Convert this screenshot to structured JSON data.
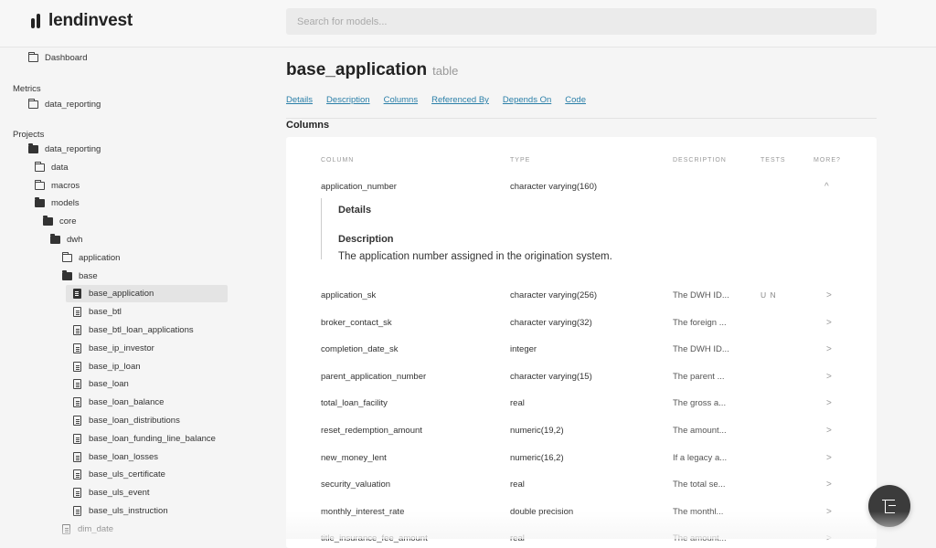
{
  "app": {
    "logo_text": "lendinvest",
    "logo_icon": "lendinvest-logo-icon"
  },
  "search": {
    "placeholder": "Search for models..."
  },
  "sidebar": {
    "dashboard": "Dashboard",
    "metrics_heading": "Metrics",
    "metrics_item": "data_reporting",
    "projects_heading": "Projects",
    "tree": [
      {
        "label": "data_reporting",
        "icon": "folder-open-icon"
      },
      {
        "label": "data",
        "icon": "folder-icon"
      },
      {
        "label": "macros",
        "icon": "folder-icon"
      },
      {
        "label": "models",
        "icon": "folder-open-icon"
      },
      {
        "label": "core",
        "icon": "folder-open-icon"
      },
      {
        "label": "dwh",
        "icon": "folder-open-icon"
      },
      {
        "label": "application",
        "icon": "folder-icon"
      },
      {
        "label": "base",
        "icon": "folder-open-icon"
      },
      {
        "label": "base_application",
        "icon": "file-filled-icon",
        "active": true
      },
      {
        "label": "base_btl",
        "icon": "file-icon"
      },
      {
        "label": "base_btl_loan_applications",
        "icon": "file-icon"
      },
      {
        "label": "base_ip_investor",
        "icon": "file-icon"
      },
      {
        "label": "base_ip_loan",
        "icon": "file-icon"
      },
      {
        "label": "base_loan",
        "icon": "file-icon"
      },
      {
        "label": "base_loan_balance",
        "icon": "file-icon"
      },
      {
        "label": "base_loan_distributions",
        "icon": "file-icon"
      },
      {
        "label": "base_loan_funding_line_balance",
        "icon": "file-icon"
      },
      {
        "label": "base_loan_losses",
        "icon": "file-icon"
      },
      {
        "label": "base_uls_certificate",
        "icon": "file-icon"
      },
      {
        "label": "base_uls_event",
        "icon": "file-icon"
      },
      {
        "label": "base_uls_instruction",
        "icon": "file-icon"
      },
      {
        "label": "dim_date",
        "icon": "file-icon"
      }
    ]
  },
  "main": {
    "title": "base_application",
    "title_type": "table",
    "tabs": [
      "Details",
      "Description",
      "Columns",
      "Referenced By",
      "Depends On",
      "Code"
    ],
    "section": "Columns",
    "columns_header": {
      "column": "COLUMN",
      "type": "TYPE",
      "description": "DESCRIPTION",
      "tests": "TESTS",
      "more": "MORE?"
    },
    "expanded": {
      "column": "application_number",
      "type": "character varying(160)",
      "chevron": "^",
      "details_label": "Details",
      "description_label": "Description",
      "description_text": "The application number assigned in the origination system."
    },
    "rows": [
      {
        "column": "application_sk",
        "type": "character varying(256)",
        "description": "The DWH ID...",
        "tests": "U N",
        "more": ">"
      },
      {
        "column": "broker_contact_sk",
        "type": "character varying(32)",
        "description": "The foreign ...",
        "tests": "",
        "more": ">"
      },
      {
        "column": "completion_date_sk",
        "type": "integer",
        "description": "The DWH ID...",
        "tests": "",
        "more": ">"
      },
      {
        "column": "parent_application_number",
        "type": "character varying(15)",
        "description": "The parent ...",
        "tests": "",
        "more": ">"
      },
      {
        "column": "total_loan_facility",
        "type": "real",
        "description": "The gross a...",
        "tests": "",
        "more": ">"
      },
      {
        "column": "reset_redemption_amount",
        "type": "numeric(19,2)",
        "description": "The amount...",
        "tests": "",
        "more": ">"
      },
      {
        "column": "new_money_lent",
        "type": "numeric(16,2)",
        "description": "If a legacy a...",
        "tests": "",
        "more": ">"
      },
      {
        "column": "security_valuation",
        "type": "real",
        "description": "The total se...",
        "tests": "",
        "more": ">"
      },
      {
        "column": "monthly_interest_rate",
        "type": "double precision",
        "description": "The monthl...",
        "tests": "",
        "more": ">"
      },
      {
        "column": "title_insurance_fee_amount",
        "type": "real",
        "description": "The amount...",
        "tests": "",
        "more": ">"
      }
    ]
  },
  "fab": {
    "icon": "lineage-graph-icon"
  }
}
